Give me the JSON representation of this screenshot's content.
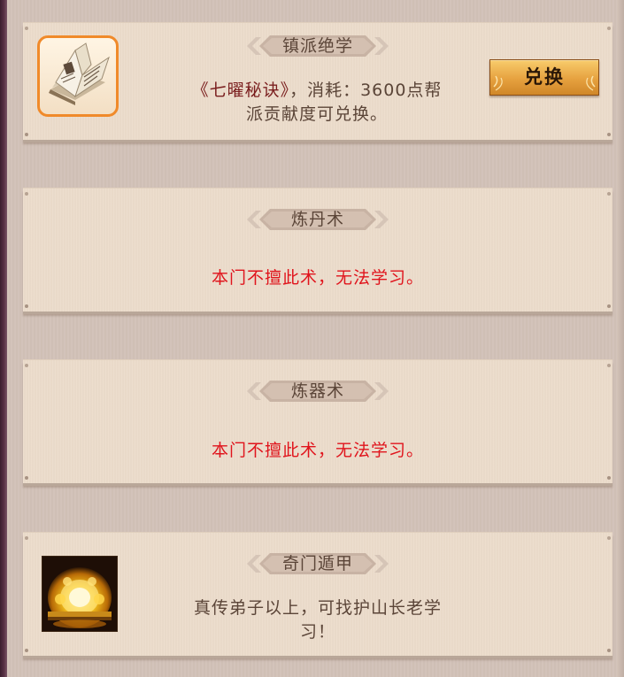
{
  "cards": [
    {
      "title": "镇派绝学",
      "desc_book": "《七曜秘诀》",
      "desc_line1_rest": "，消耗：3600点帮",
      "desc_line2": "派贡献度可兑换。",
      "button_label": "兑换",
      "icon": "open-book-icon"
    },
    {
      "title": "炼丹术",
      "warning": "本门不擅此术，无法学习。"
    },
    {
      "title": "炼器术",
      "warning": "本门不擅此术，无法学习。"
    },
    {
      "title": "奇门遁甲",
      "desc_line1": "真传弟子以上，可找护山长老学",
      "desc_line2": "习！",
      "icon": "golden-sun-icon"
    }
  ],
  "colors": {
    "warning": "#e0141c",
    "text": "#5b4538",
    "book_title": "#7a1e1e",
    "button": "#e6a13f",
    "icon_border": "#f08a2a"
  }
}
